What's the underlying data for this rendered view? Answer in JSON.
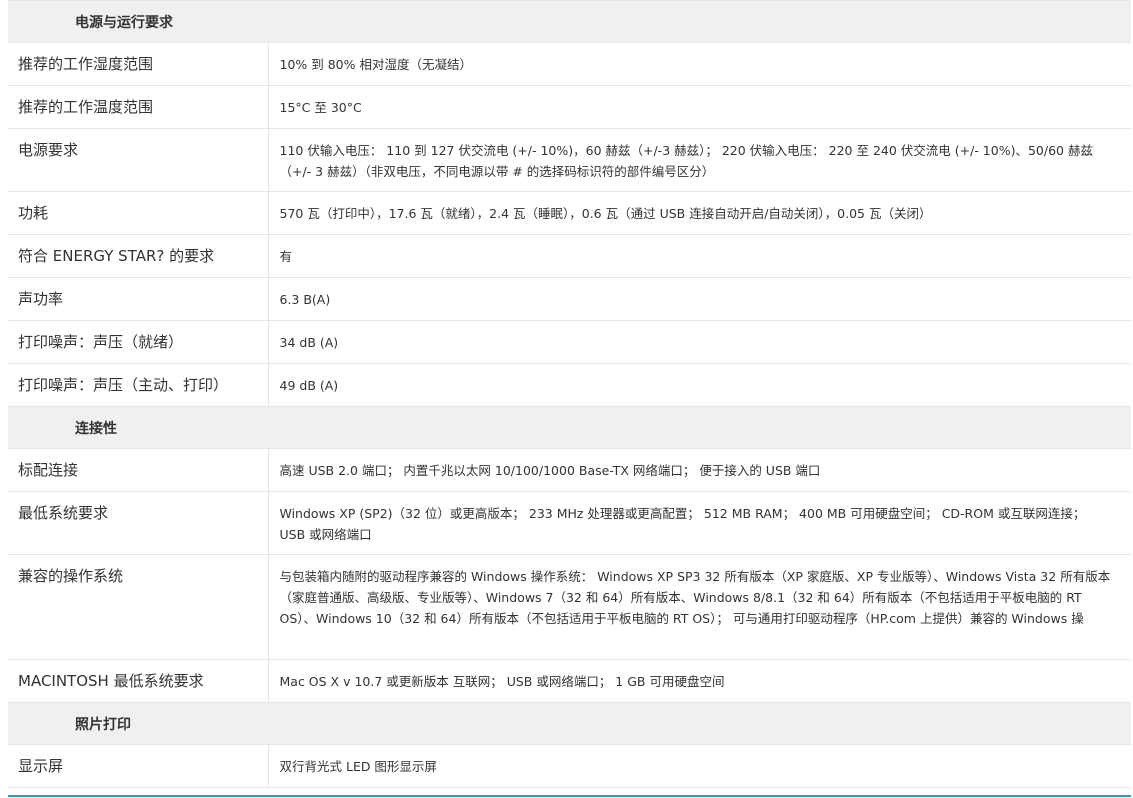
{
  "sections": [
    {
      "title": "电源与运行要求",
      "rows": [
        {
          "label": "推荐的工作湿度范围",
          "value": "10% 到 80% 相对湿度（无凝结）"
        },
        {
          "label": "推荐的工作温度范围",
          "value": "15°C 至 30°C"
        },
        {
          "label": "电源要求",
          "value": "110 伏输入电压： 110 到 127 伏交流电 (+/- 10%)，60 赫兹（+/-3 赫兹）； 220 伏输入电压： 220 至 240 伏交流电 (+/- 10%)、50/60 赫兹（+/- 3 赫兹）（非双电压，不同电源以带 # 的选择码标识符的部件编号区分）"
        },
        {
          "label": "功耗",
          "value": "570 瓦（打印中），17.6 瓦（就绪），2.4 瓦（睡眠），0.6 瓦（通过 USB 连接自动开启/自动关闭），0.05 瓦（关闭）"
        },
        {
          "label": "符合 ENERGY STAR? 的要求",
          "value": "有"
        },
        {
          "label": "声功率",
          "value": "6.3 B(A)"
        },
        {
          "label": "打印噪声：声压（就绪）",
          "value": "34 dB (A)"
        },
        {
          "label": "打印噪声：声压（主动、打印）",
          "value": "49 dB (A)"
        }
      ]
    },
    {
      "title": "连接性",
      "rows": [
        {
          "label": "标配连接",
          "value": "高速 USB 2.0 端口； 内置千兆以太网 10/100/1000 Base-TX 网络端口； 便于接入的 USB 端口"
        },
        {
          "label": "最低系统要求",
          "value": "Windows XP (SP2)（32 位）或更高版本； 233 MHz 处理器或更高配置； 512 MB RAM； 400 MB 可用硬盘空间； CD-ROM 或互联网连接； USB 或网络端口"
        },
        {
          "label": "兼容的操作系统",
          "value": "与包装箱内随附的驱动程序兼容的 Windows 操作系统： Windows XP SP3 32 所有版本（XP 家庭版、XP 专业版等）、Windows Vista 32 所有版本（家庭普通版、高级版、专业版等）、Windows 7（32 和 64）所有版本、Windows 8/8.1（32 和 64）所有版本（不包括适用于平板电脑的 RT OS）、Windows 10（32 和 64）所有版本（不包括适用于平板电脑的 RT OS）； 可与通用打印驱动程序（HP.com 上提供）兼容的 Windows 操"
        },
        {
          "label": "MACINTOSH 最低系统要求",
          "value": "Mac OS X v 10.7 或更新版本 互联网； USB 或网络端口； 1 GB 可用硬盘空间"
        }
      ]
    },
    {
      "title": "照片打印",
      "rows": [
        {
          "label": "显示屏",
          "value": "双行背光式 LED 图形显示屏"
        }
      ]
    }
  ]
}
